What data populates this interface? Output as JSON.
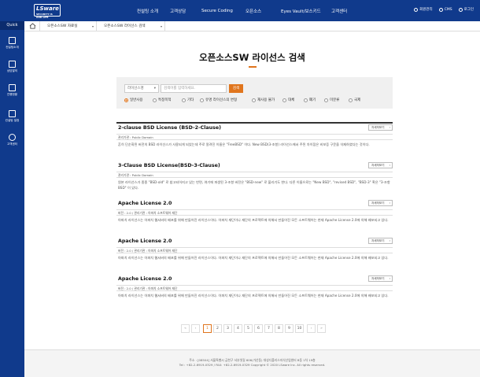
{
  "header": {
    "logo": "LSware",
    "logo_sub": "SECURITY IS OUR LIFE",
    "nav": [
      "컨설팅 소개",
      "고객상담",
      "Secure Coding",
      "오픈소스",
      "Eyes Vault/보스키드",
      "고객센터"
    ],
    "util": [
      "회원관리",
      "CMS",
      "로그인"
    ]
  },
  "sidebar": {
    "quick": "Quick",
    "items": [
      "컨설팅소개",
      "상담발의",
      "진행현황",
      "컨설팅 일정",
      "고객센터"
    ]
  },
  "breadcrumb": [
    "오픈소스SW 자료실",
    "오픈소스SW 라이선스 검색"
  ],
  "page": {
    "title": "오픈소스SW 라이선스 검색"
  },
  "search": {
    "select_value": "라이선스명",
    "placeholder": "검색어를 입력하세요.",
    "button": "검색",
    "options": [
      "일반사용",
      "특정목적",
      "기타",
      "유명 라이선스의 변형",
      "재사용 불가",
      "대체",
      "폐기",
      "미분류",
      "국제"
    ],
    "selected": "일반사용"
  },
  "detail_label": "자세히보기",
  "licenses": [
    {
      "name": "2-clause BSD License (BSD-2-Clause)",
      "meta": "관리기관 : Public Domain",
      "desc": "흔히 단순화된 버전의 BSD 라이선스가 사용되게 되었는데 주로 알려진 이름은 \"FreeBSD\" 이다. New BSD(3-조항) 라이선스에서 주된 차이점은 비보증 구문을 삭제하였다는 것이다."
    },
    {
      "name": "3-Clause BSD License(BSD-3-Clause)",
      "meta": "관리기관 : Public Domain",
      "desc": "원본 라이선스가 종종 \"BSD-old\" 로 참고되어지고 있는 반면, 여기에 파생된 3-조항 버전은 \"BSD-new\" 로 불리기도 한다. 다른 이름으로는 \"New BSD\", \"revised BSD\", \"BSD-3\" 혹은 \"3-조항BSD\" 이 있다."
    },
    {
      "name": "Apache License 2.0",
      "meta": "버전 : 2.0 / 관리기관 : 아파치 소프트웨어 재단",
      "desc": "아파치 라이선스는 아파치 웹서버의 배포를 위해 만들어진 라이선스이다. 아파치 재단이나 재단의 프로젝트에 의해서 만들어진 모든 소프트웨어는 현재 Apache License 2.0에 의해 배포되고 있다."
    },
    {
      "name": "Apache License 2.0",
      "meta": "버전 : 2.0 / 관리기관 : 아파치 소프트웨어 재단",
      "desc": "아파치 라이선스는 아파치 웹서버의 배포를 위해 만들어진 라이선스이다. 아파치 재단이나 재단의 프로젝트에 의해서 만들어진 모든 소프트웨어는 현재 Apache License 2.0에 의해 배포되고 있다."
    },
    {
      "name": "Apache License 2.0",
      "meta": "버전 : 2.0 / 관리기관 : 아파치 소프트웨어 재단",
      "desc": "아파치 라이선스는 아파치 웹서버의 배포를 위해 만들어진 라이선스이다. 아파치 재단이나 재단의 프로젝트에 의해서 만들어진 모든 소프트웨어는 현재 Apache License 2.0에 의해 배포되고 있다."
    }
  ],
  "pagination": {
    "first": "«",
    "prev": "‹",
    "next": "›",
    "last": "»",
    "pages": [
      "1",
      "2",
      "3",
      "4",
      "5",
      "6",
      "7",
      "8",
      "9",
      "10"
    ],
    "current": "1"
  },
  "footer": {
    "line1": "주소 : [08504] 서울특별시 금천구 서부샛길 606(가산동) 대성디폴리스지식산업센터 B동 1차 19층",
    "line2": "Tel : +82-2-6919-0329 / FAX: +82-2-6919-0329   Copyright © 2020 LSware Inc. All rights reserved."
  },
  "colors": {
    "primary": "#103a8c",
    "accent": "#e0751d"
  }
}
